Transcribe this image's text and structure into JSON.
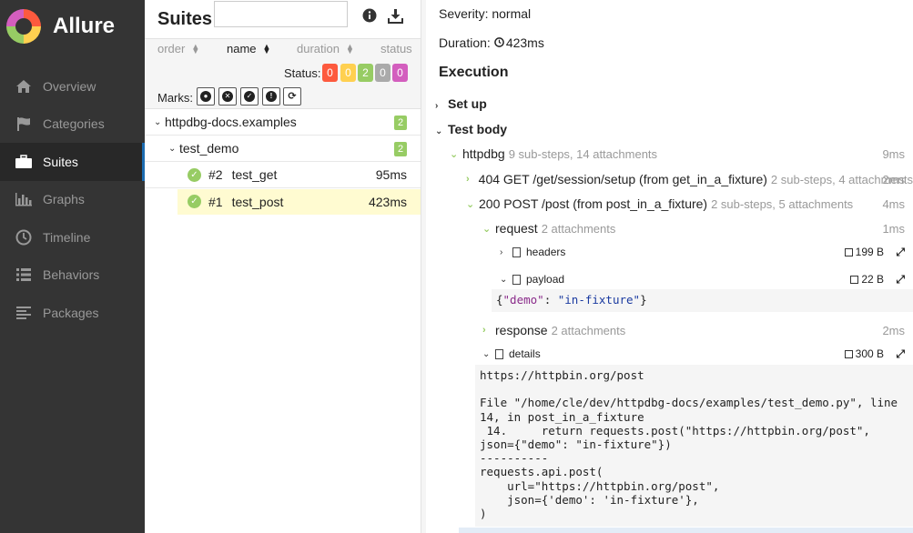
{
  "app": {
    "name": "Allure"
  },
  "nav": [
    {
      "label": "Overview",
      "icon": "home-icon"
    },
    {
      "label": "Categories",
      "icon": "flag-icon"
    },
    {
      "label": "Suites",
      "icon": "briefcase-icon",
      "active": true
    },
    {
      "label": "Graphs",
      "icon": "bar-chart-icon"
    },
    {
      "label": "Timeline",
      "icon": "clock-icon"
    },
    {
      "label": "Behaviors",
      "icon": "list-icon"
    },
    {
      "label": "Packages",
      "icon": "align-left-icon"
    }
  ],
  "suites": {
    "title": "Suites",
    "search": {
      "value": "",
      "placeholder": ""
    },
    "sort": {
      "order": "order",
      "name": "name",
      "duration": "duration",
      "status": "status"
    },
    "status_label": "Status:",
    "status_counts": [
      {
        "value": "0",
        "color": "#fd5a3e"
      },
      {
        "value": "0",
        "color": "#ffd050"
      },
      {
        "value": "2",
        "color": "#97cc64"
      },
      {
        "value": "0",
        "color": "#aaaaaa"
      },
      {
        "value": "0",
        "color": "#d35ebe"
      }
    ],
    "marks_label": "Marks:",
    "tree": {
      "root": {
        "name": "httpdbg-docs.examples",
        "count": "2"
      },
      "group": {
        "name": "test_demo",
        "count": "2"
      },
      "tests": [
        {
          "num": "#2",
          "name": "test_get",
          "duration": "95ms"
        },
        {
          "num": "#1",
          "name": "test_post",
          "duration": "423ms",
          "selected": true
        }
      ]
    }
  },
  "detail": {
    "severity": "Severity: normal",
    "duration": "Duration:",
    "duration_value": "423ms",
    "execution": "Execution",
    "setup": "Set up",
    "test_body": "Test body",
    "steps": {
      "httpdbg": {
        "name": "httpdbg",
        "meta": "9 sub-steps, 14 attachments",
        "duration": "9ms"
      },
      "get": {
        "name": "404 GET /get/session/setup (from get_in_a_fixture)",
        "meta": "2 sub-steps, 4 attachments",
        "duration": "2ms"
      },
      "post": {
        "name": "200 POST /post (from post_in_a_fixture)",
        "meta": "2 sub-steps, 5 attachments",
        "duration": "4ms"
      },
      "request": {
        "name": "request",
        "meta": "2 attachments",
        "duration": "1ms"
      },
      "headers": {
        "name": "headers",
        "size": "199 B"
      },
      "payload": {
        "name": "payload",
        "size": "22 B"
      },
      "response": {
        "name": "response",
        "meta": "2 attachments",
        "duration": "2ms"
      },
      "details": {
        "name": "details",
        "size": "300 B"
      }
    },
    "payload_json": {
      "key": "\"demo\"",
      "sep": ": ",
      "value": "\"in-fixture\"",
      "open": "{",
      "close": "}"
    },
    "details_text": "https://httpbin.org/post\n\nFile \"/home/cle/dev/httpdbg-docs/examples/test_demo.py\", line\n14, in post_in_a_fixture\n 14.     return requests.post(\"https://httpbin.org/post\",\njson={\"demo\": \"in-fixture\"})\n----------\nrequests.api.post(\n    url=\"https://httpbin.org/post\",\n    json={'demo': 'in-fixture'},\n)"
  }
}
